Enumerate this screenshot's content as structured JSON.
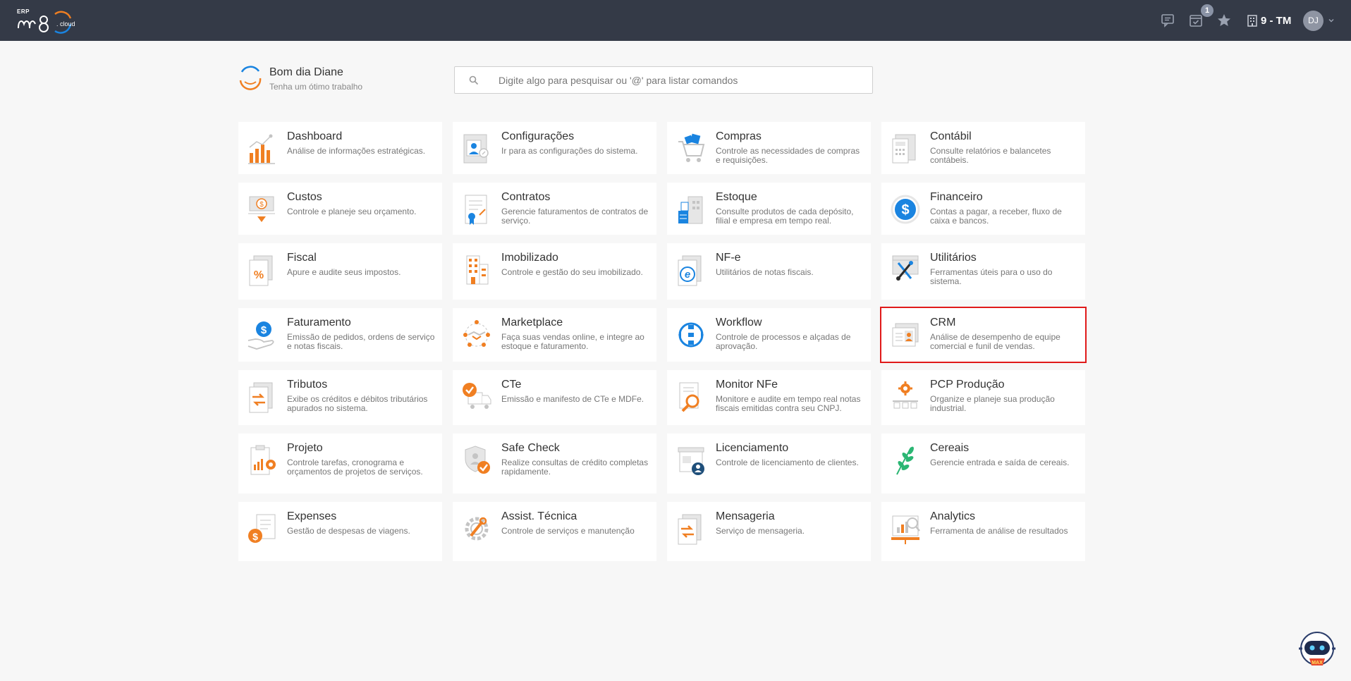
{
  "topbar": {
    "logo_label": "ERP",
    "logo_text": "m8",
    "logo_suffix": "cloud",
    "icons": [
      "chat-icon",
      "calendar-check-icon",
      "star-icon",
      "building-icon"
    ],
    "notification_count": "1",
    "company": "9 - TM",
    "user_initials": "DJ",
    "colors": {
      "background": "#343a47",
      "accent_orange": "#f07f22",
      "accent_blue": "#1a84e0"
    }
  },
  "greeting": {
    "title": "Bom dia Diane",
    "subtitle": "Tenha um ótimo trabalho"
  },
  "search": {
    "placeholder": "Digite algo para pesquisar ou '@' para listar comandos",
    "icon": "search-icon"
  },
  "modules": [
    {
      "id": "dashboard",
      "title": "Dashboard",
      "desc": "Análise de informações estratégicas.",
      "icon": "bar-chart-icon"
    },
    {
      "id": "configuracoes",
      "title": "Configurações",
      "desc": "Ir para as configurações do sistema.",
      "icon": "settings-profile-icon"
    },
    {
      "id": "compras",
      "title": "Compras",
      "desc": "Controle as necessidades de compras e requisições.",
      "icon": "shopping-cart-icon"
    },
    {
      "id": "contabil",
      "title": "Contábil",
      "desc": "Consulte relatórios e balancetes contábeis.",
      "icon": "calculator-document-icon"
    },
    {
      "id": "custos",
      "title": "Custos",
      "desc": "Controle e planeje seu orçamento.",
      "icon": "money-down-icon"
    },
    {
      "id": "contratos",
      "title": "Contratos",
      "desc": "Gerencie faturamentos de contratos de serviço.",
      "icon": "contract-icon"
    },
    {
      "id": "estoque",
      "title": "Estoque",
      "desc": "Consulte produtos de cada depósito, filial e empresa em tempo real.",
      "icon": "warehouse-icon"
    },
    {
      "id": "financeiro",
      "title": "Financeiro",
      "desc": "Contas a pagar, a receber, fluxo de caixa e bancos.",
      "icon": "dollar-circle-icon"
    },
    {
      "id": "fiscal",
      "title": "Fiscal",
      "desc": "Apure e audite seus impostos.",
      "icon": "percent-document-icon"
    },
    {
      "id": "imobilizado",
      "title": "Imobilizado",
      "desc": "Controle e gestão do seu imobilizado.",
      "icon": "building-assets-icon"
    },
    {
      "id": "nfe",
      "title": "NF-e",
      "desc": "Utilitários de notas fiscais.",
      "icon": "e-document-icon"
    },
    {
      "id": "utilitarios",
      "title": "Utilitários",
      "desc": "Ferramentas úteis para o uso do sistema.",
      "icon": "tools-icon"
    },
    {
      "id": "faturamento",
      "title": "Faturamento",
      "desc": "Emissão de pedidos, ordens de serviço e notas fiscais.",
      "icon": "hand-dollar-icon"
    },
    {
      "id": "marketplace",
      "title": "Marketplace",
      "desc": "Faça suas vendas online, e integre ao estoque e faturamento.",
      "icon": "handshake-network-icon"
    },
    {
      "id": "workflow",
      "title": "Workflow",
      "desc": "Controle de processos e alçadas de aprovação.",
      "icon": "workflow-cycle-icon"
    },
    {
      "id": "crm",
      "title": "CRM",
      "desc": "Análise de desempenho de equipe comercial e funil de vendas.",
      "icon": "crm-card-icon"
    },
    {
      "id": "tributos",
      "title": "Tributos",
      "desc": "Exibe os créditos e débitos tributários apurados no sistema.",
      "icon": "transfer-document-icon"
    },
    {
      "id": "cte",
      "title": "CTe",
      "desc": "Emissão e manifesto de CTe e MDFe.",
      "icon": "truck-check-icon"
    },
    {
      "id": "monitor_nfe",
      "title": "Monitor NFe",
      "desc": "Monitore e audite em tempo real notas fiscais emitidas contra seu CNPJ.",
      "icon": "document-search-icon"
    },
    {
      "id": "pcp",
      "title": "PCP Produção",
      "desc": "Organize e planeje sua produção industrial.",
      "icon": "production-gear-icon"
    },
    {
      "id": "projeto",
      "title": "Projeto",
      "desc": "Controle tarefas, cronograma e orçamentos de projetos de serviços.",
      "icon": "project-clipboard-icon"
    },
    {
      "id": "safe_check",
      "title": "Safe Check",
      "desc": "Realize consultas de crédito completas rapidamente.",
      "icon": "shield-check-icon"
    },
    {
      "id": "licenciamento",
      "title": "Licenciamento",
      "desc": "Controle de licenciamento de clientes.",
      "icon": "store-user-icon"
    },
    {
      "id": "cereais",
      "title": "Cereais",
      "desc": "Gerencie entrada e saída de cereais.",
      "icon": "grain-icon"
    },
    {
      "id": "expenses",
      "title": "Expenses",
      "desc": "Gestão de despesas de viagens.",
      "icon": "expense-dollar-icon"
    },
    {
      "id": "assist",
      "title": "Assist. Técnica",
      "desc": "Controle de serviços e manutenção",
      "icon": "wrench-gear-icon"
    },
    {
      "id": "mensageria",
      "title": "Mensageria",
      "desc": "Serviço de mensageria.",
      "icon": "message-transfer-icon"
    },
    {
      "id": "analytics",
      "title": "Analytics",
      "desc": "Ferramenta de análise de resultados",
      "icon": "analytics-screen-icon"
    }
  ],
  "assistant": {
    "label": "MAX",
    "icon": "robot-assistant-icon"
  }
}
